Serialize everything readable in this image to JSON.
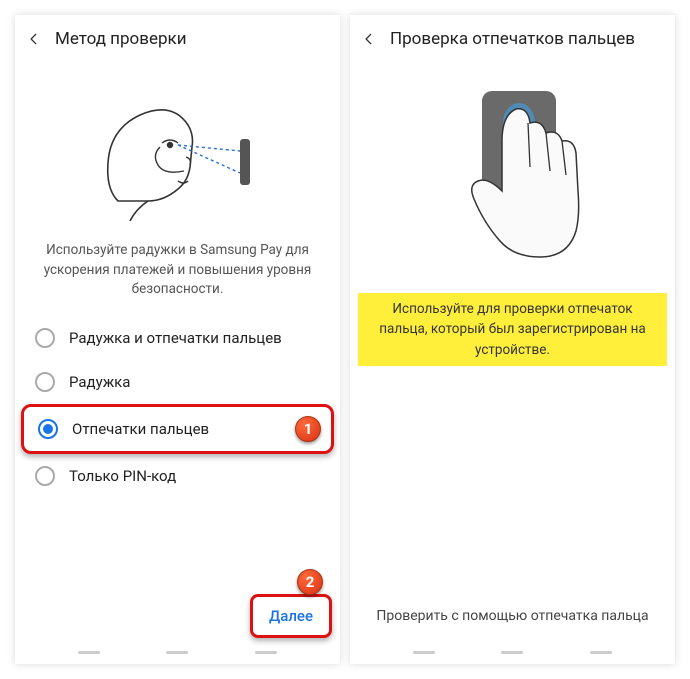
{
  "left": {
    "title": "Метод проверки",
    "description": "Используйте радужки в Samsung Pay для ускорения платежей и повышения уровня безопасности.",
    "options": [
      {
        "label": "Радужка и отпечатки пальцев",
        "selected": false
      },
      {
        "label": "Радужка",
        "selected": false
      },
      {
        "label": "Отпечатки пальцев",
        "selected": true
      },
      {
        "label": "Только PIN-код",
        "selected": false
      }
    ],
    "next_label": "Далее",
    "callout1": "1",
    "callout2": "2"
  },
  "right": {
    "title": "Проверка отпечатков пальцев",
    "highlight_text": "Используйте для проверки отпечаток пальца, который был зарегистрирован на устройстве.",
    "footer_text": "Проверить с помощью отпечатка пальца"
  }
}
